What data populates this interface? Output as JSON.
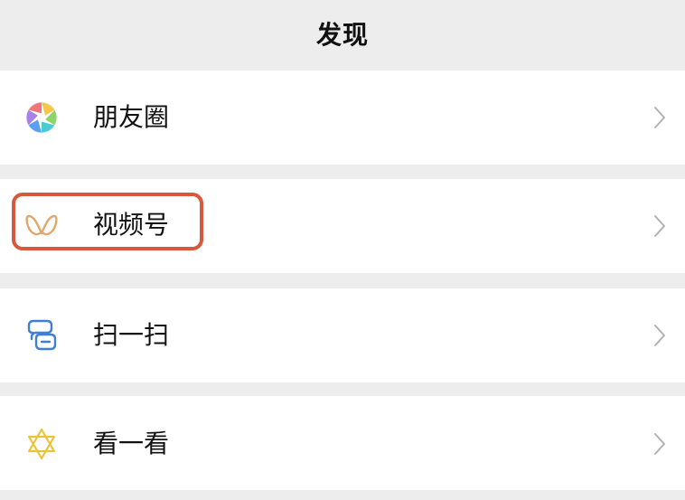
{
  "header": {
    "title": "发现"
  },
  "menu": {
    "items": [
      {
        "label": "朋友圈",
        "icon": "moments-aperture-icon"
      },
      {
        "label": "视频号",
        "icon": "channels-butterfly-icon"
      },
      {
        "label": "扫一扫",
        "icon": "scan-icon"
      },
      {
        "label": "看一看",
        "icon": "top-stories-star-icon"
      }
    ]
  },
  "colors": {
    "background": "#ededed",
    "cell": "#ffffff",
    "chevron": "#b2b2b2",
    "highlight": "#d9573b",
    "channels_icon": "#e0a86b",
    "scan_icon": "#3f7fd8",
    "top_stories_icon": "#e9c43a"
  }
}
